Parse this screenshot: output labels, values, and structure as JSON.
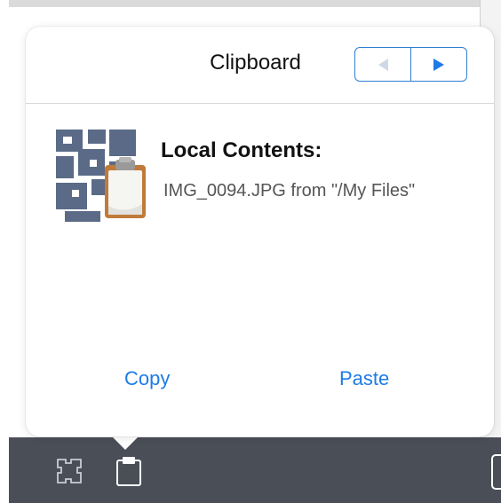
{
  "popover": {
    "title": "Clipboard",
    "nav": {
      "prev_icon": "triangle-left-icon",
      "next_icon": "triangle-right-icon"
    },
    "content": {
      "icon": "puzzle-clipboard-icon",
      "heading": "Local Contents:",
      "item": "IMG_0094.JPG from \"/My Files\""
    },
    "actions": {
      "copy_label": "Copy",
      "paste_label": "Paste"
    }
  },
  "toolbar": {
    "icons": [
      "puzzle-icon",
      "clipboard-icon"
    ]
  },
  "colors": {
    "accent": "#1e7be6",
    "toolbar": "#4a4e57",
    "icon_slate": "#5b6b87",
    "clipboard_brown": "#c07a3a"
  }
}
